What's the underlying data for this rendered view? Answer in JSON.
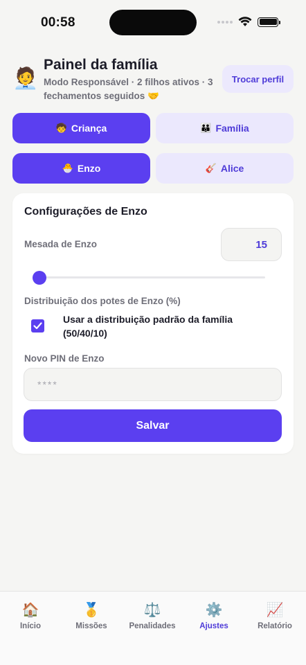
{
  "status_bar": {
    "time": "00:58"
  },
  "header": {
    "avatar_emoji": "🧑‍💼",
    "title": "Painel da família",
    "subtitle": "Modo Responsável · 2 filhos ativos · 3 fechamentos seguidos 🤝",
    "switch_profile_label": "Trocar perfil"
  },
  "mode_tabs": [
    {
      "emoji": "🧒",
      "label": "Criança",
      "active": true
    },
    {
      "emoji": "👪",
      "label": "Família",
      "active": false
    }
  ],
  "child_tabs": [
    {
      "emoji": "🐣",
      "label": "Enzo",
      "active": true
    },
    {
      "emoji": "🎸",
      "label": "Alice",
      "active": false
    }
  ],
  "settings": {
    "title": "Configurações de Enzo",
    "allowance_label": "Mesada de Enzo",
    "allowance_value": "15",
    "allowance_slider_fraction": 0.0,
    "distribution_label": "Distribuição dos potes de Enzo (%)",
    "use_default_checked": true,
    "use_default_label": "Usar a distribuição padrão da família (50/40/10)",
    "pin_label": "Novo PIN de Enzo",
    "pin_placeholder": "****",
    "save_label": "Salvar"
  },
  "colors": {
    "accent": "#5b3ff0",
    "accent_soft": "#ebe8fd",
    "accent_text": "#4e3bd8"
  },
  "tabbar": [
    {
      "icon": "house-icon",
      "emoji": "🏠",
      "label": "Início",
      "active": false
    },
    {
      "icon": "medal-icon",
      "emoji": "🥇",
      "label": "Missões",
      "active": false
    },
    {
      "icon": "scales-icon",
      "emoji": "⚖️",
      "label": "Penalidades",
      "active": false
    },
    {
      "icon": "gear-icon",
      "emoji": "⚙️",
      "label": "Ajustes",
      "active": true
    },
    {
      "icon": "chart-icon",
      "emoji": "📈",
      "label": "Relatório",
      "active": false
    }
  ]
}
